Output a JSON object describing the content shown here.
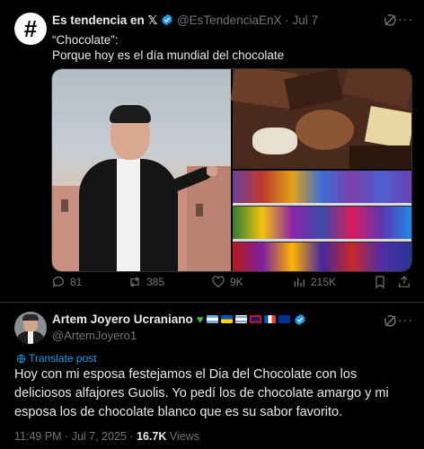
{
  "quoted": {
    "avatar_glyph": "#",
    "display_name": "Es tendencia en 𝕏",
    "handle": "@EsTendenciaEnX",
    "separator": "·",
    "date": "Jul 7",
    "line1": "“Chocolate”:",
    "line2": "Porque hoy es el día mundial del chocolate",
    "actions": {
      "replies": "81",
      "reposts": "385",
      "likes": "9K",
      "views": "215K"
    }
  },
  "main": {
    "display_name": "Artem Joyero Ucraniano",
    "handle": "@ArtemJoyero1",
    "translate": "Translate post",
    "text": "Hoy con mi esposa festejamos el Dia del Chocolate con los deliciosos alfajores Guolis. Yo pedí los de chocolate amargo y mi esposa los de chocolate blanco que es su sabor favorito.",
    "time": "11:49 PM",
    "separator": "·",
    "date": "Jul 7, 2025",
    "separator2": "·",
    "views_count": "16.7K",
    "views_label": "Views"
  },
  "colors": {
    "accent": "#1d9bf0",
    "verified": "#1d9bf0",
    "muted": "#71767b",
    "heart": "#3fb950"
  },
  "icons": [
    "grok-icon",
    "more-icon",
    "reply-icon",
    "repost-icon",
    "like-icon",
    "views-icon",
    "bookmark-icon",
    "share-icon",
    "verified-badge-icon",
    "globe-icon"
  ]
}
